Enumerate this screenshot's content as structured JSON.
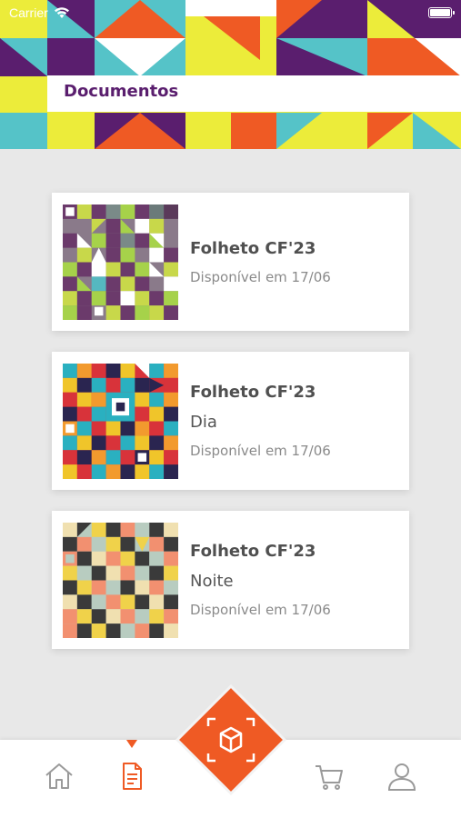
{
  "status_bar": {
    "carrier": "Carrier",
    "wifi_icon": "wifi-icon",
    "battery_icon": "battery-icon"
  },
  "header": {
    "title": "Documentos",
    "colors": {
      "purple": "#5a1e6e",
      "orange": "#ef5a24",
      "teal": "#55c3c8",
      "yellow": "#ecec3a",
      "white": "#ffffff"
    }
  },
  "documents": [
    {
      "title": "Folheto CF'23",
      "subtitle": "",
      "availability": "Disponível em 17/06",
      "thumbnail": "pattern-purple-lime"
    },
    {
      "title": "Folheto CF'23",
      "subtitle": "Dia",
      "availability": "Disponível em 17/06",
      "thumbnail": "pattern-red-teal"
    },
    {
      "title": "Folheto CF'23",
      "subtitle": "Noite",
      "availability": "Disponível em 17/06",
      "thumbnail": "pattern-salmon-grey"
    }
  ],
  "bottom_nav": {
    "items": [
      {
        "icon": "home-icon",
        "active": false
      },
      {
        "icon": "document-icon",
        "active": true
      },
      {
        "icon": "scan-box-icon",
        "active": false
      },
      {
        "icon": "cart-icon",
        "active": false
      },
      {
        "icon": "user-icon",
        "active": false
      }
    ],
    "accent_color": "#ef5a24",
    "inactive_color": "#9a9a9a"
  }
}
